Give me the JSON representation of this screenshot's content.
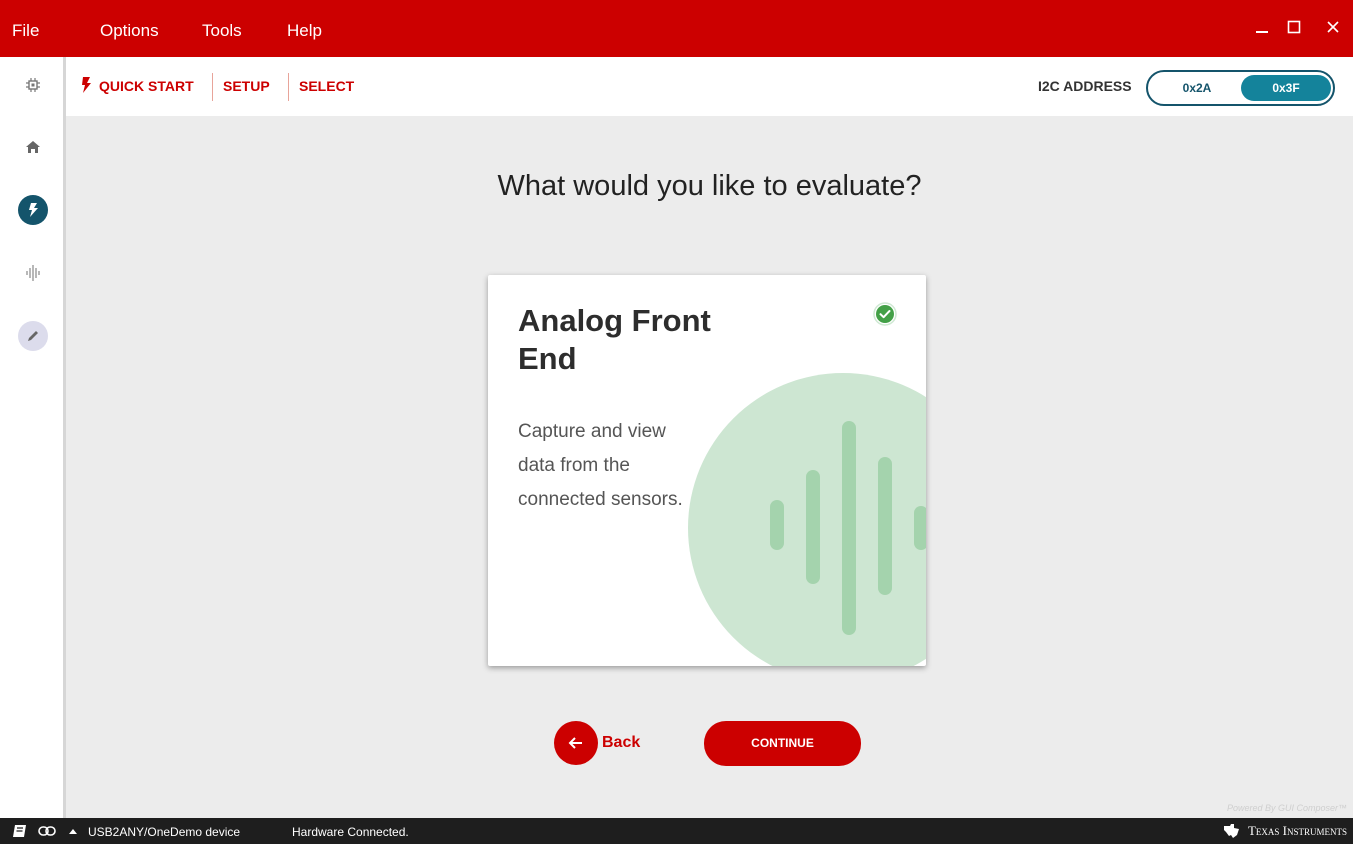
{
  "menubar": {
    "items": [
      "File",
      "Options",
      "Tools",
      "Help"
    ],
    "window_controls": [
      "minimize-icon",
      "maximize-icon",
      "close-icon"
    ]
  },
  "rail": {
    "items": [
      "chip-icon",
      "home-icon",
      "quick-start-bolt-icon",
      "waveform-icon",
      "pencil-icon"
    ],
    "active": "quick-start-bolt-icon"
  },
  "breadcrumb": {
    "items": [
      "QUICK START",
      "SETUP",
      "SELECT"
    ]
  },
  "i2c": {
    "label": "I2C ADDRESS",
    "options": [
      "0x2A",
      "0x3F"
    ],
    "selected": "0x3F"
  },
  "main": {
    "heading": "What would you like to evaluate?",
    "card": {
      "title": "Analog Front End",
      "description": "Capture and view data from the connected sensors.",
      "selected": true
    },
    "back_label": "Back",
    "continue_label": "CONTINUE"
  },
  "footer": {
    "powered_by": "Powered By GUI Composer™"
  },
  "statusbar": {
    "device": "USB2ANY/OneDemo device",
    "status": "Hardware Connected.",
    "brand": "Texas Instruments"
  },
  "colors": {
    "brand_red": "#cc0000",
    "accent_teal": "#14546b",
    "success_green": "#43a047",
    "art_green": "#cde6d2"
  }
}
